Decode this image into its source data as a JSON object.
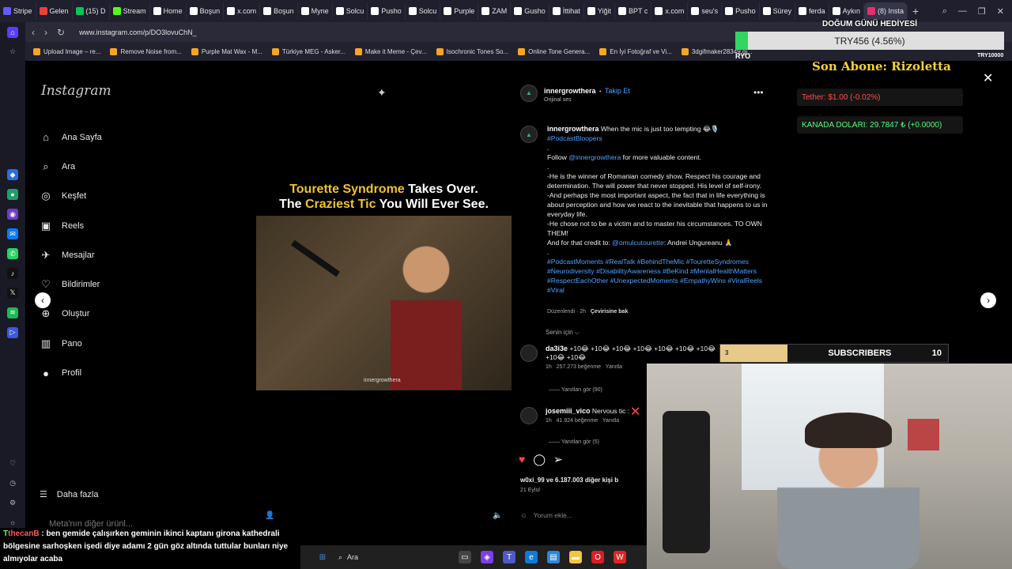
{
  "browser": {
    "tabs": [
      {
        "label": "Stripe",
        "color": "#635bff"
      },
      {
        "label": "Gelen",
        "color": "#ea4335"
      },
      {
        "label": "(15) D",
        "color": "#00c853"
      },
      {
        "label": "Stream",
        "color": "#53fc18"
      },
      {
        "label": "Home",
        "color": "#ffffff"
      },
      {
        "label": "Boşun",
        "color": "#ffffff"
      },
      {
        "label": "x.com",
        "color": "#ffffff"
      },
      {
        "label": "Boşun",
        "color": "#ffffff"
      },
      {
        "label": "Myne",
        "color": "#ffffff"
      },
      {
        "label": "Solcu",
        "color": "#ffffff"
      },
      {
        "label": "Pusho",
        "color": "#ffffff"
      },
      {
        "label": "Solcu",
        "color": "#ffffff"
      },
      {
        "label": "Purple",
        "color": "#ffffff"
      },
      {
        "label": "ZAM",
        "color": "#ffffff"
      },
      {
        "label": "Gusho",
        "color": "#ffffff"
      },
      {
        "label": "İttihat",
        "color": "#ffffff"
      },
      {
        "label": "Yiğit",
        "color": "#ffffff"
      },
      {
        "label": "BPT c",
        "color": "#ffffff"
      },
      {
        "label": "x.com",
        "color": "#ffffff"
      },
      {
        "label": "seu's",
        "color": "#ffffff"
      },
      {
        "label": "Pusho",
        "color": "#ffffff"
      },
      {
        "label": "Sürey",
        "color": "#ffffff"
      },
      {
        "label": "ferda",
        "color": "#ffffff"
      },
      {
        "label": "Aykın",
        "color": "#ffffff"
      },
      {
        "label": "(8) Insta",
        "color": "#e1306c",
        "active": true
      }
    ],
    "new_tab": "+",
    "url": "www.instagram.com/p/DO3lovuChN_",
    "bookmarks": [
      "Upload Image – re...",
      "Remove Noise from...",
      "Purple Mat Wax - M...",
      "Türkiye MEG - Asker...",
      "Make it Meme - Çev...",
      "Isochronic Tones So...",
      "Online Tone Genera...",
      "En İyi Fotoğraf ve Vi...",
      "3dgifmaker28349.gi..."
    ]
  },
  "instagram": {
    "logo": "Instagram",
    "nav": [
      {
        "label": "Ana Sayfa",
        "icon": "⌂"
      },
      {
        "label": "Ara",
        "icon": "⌕"
      },
      {
        "label": "Keşfet",
        "icon": "◎"
      },
      {
        "label": "Reels",
        "icon": "▣"
      },
      {
        "label": "Mesajlar",
        "icon": "✈"
      },
      {
        "label": "Bildirimler",
        "icon": "♡"
      },
      {
        "label": "Oluştur",
        "icon": "⊕"
      },
      {
        "label": "Pano",
        "icon": "▥"
      },
      {
        "label": "Profil",
        "icon": "●"
      }
    ],
    "more": "Daha fazla",
    "meta": "Meta'nın diğer ürünl..."
  },
  "post": {
    "video_title_line1_hl": "Tourette Syndrome",
    "video_title_line1_rest": " Takes Over.",
    "video_title_line2_pre": "The ",
    "video_title_line2_hl": "Craziest Tic",
    "video_title_line2_rest": " You Will Ever See.",
    "watermark": "innergrowthera",
    "author": "innergrowthera",
    "follow": "Takip Et",
    "audio": "Orijinal ses",
    "caption_lines": [
      {
        "user": "innergrowthera",
        "text": " When the mic is just too tempting 😂🎙️"
      },
      {
        "tag": "#PodcastBloopers"
      },
      {
        "text": "."
      },
      {
        "text": "Follow ",
        "tag": "@innergrowthera",
        "text2": " for more valuable content."
      },
      {
        "text": "."
      },
      {
        "text": "-He is the winner of Romanian comedy show. Respect his courage and determination. The will power that never stopped. His level of self-irony."
      },
      {
        "text": "-And perhaps the most important aspect, the fact that in life everything is about perception and how we react to the inevitable that happens to us in everyday life."
      },
      {
        "text": "-He chose not to be a victim and to master his circumstances. TO OWN THEM!"
      },
      {
        "text": "And for that credit to: ",
        "tag": "@omulcutourette",
        "text2": ": Andrei Ungureanu 🙏"
      },
      {
        "text": "."
      },
      {
        "tag": "#PodcastMoments #RealTalk #BehindTheMic #TouretteSyndromes #Neurodiversity #DisabilityAwareness #BeKind #MentalHealthMatters #RespectEachOther #UnexpectedMoments #EmpathyWins #ViralReels #Viral"
      }
    ],
    "edited": "Düzenlendi · 2h",
    "translate": "Çevirisine bak",
    "for_you": "Senin için ⌵",
    "comments": [
      {
        "user": "da3i3e",
        "text": " +10😂 +10😂 +10😂 +10😂 +10😂 +10😂 +10😂 +10😂 +10😂",
        "time": "1h",
        "likes": "257.273 beğenme",
        "reply": "Yanıtla",
        "replies": "Yanıtları gör (90)"
      },
      {
        "user": "josemiii_vico",
        "text": " Nervous tic : ❌",
        "time": "1h",
        "likes": "41.924 beğenme",
        "reply": "Yanıtla",
        "replies": "Yanıtları gör (5)"
      }
    ],
    "liked_by": "w0xi_99 ve 6.187.003 diğer kişi b",
    "date": "21 Eylül",
    "add_comment": "Yorum ekle..."
  },
  "stream": {
    "birthday": "DOĞUM GÜNÜ HEDİYESİ",
    "goal": "TRY456 (4.56%)",
    "goal_fraction": 0.0456,
    "goal_left": "RYO",
    "goal_right": "TRY10000",
    "last_sub": "Son Abone: Rizoletta",
    "tether": "Tether: $1.00 (-0.02%)",
    "cad": "KANADA DOLARI: 29.7847 ₺ (+0.0000)",
    "subs_progress": "3",
    "subs_label": "SUBSCRIBERS",
    "subs_count": "10",
    "chat_user": "thecanB",
    "chat_text": " : ben gemide çalışırken geminin ikinci kaptanı girona kathedrali bölgesine sarhoşken işedi diye adamı 2 gün göz altında tuttular bunları niye almıyolar acaba"
  },
  "taskbar": {
    "search": "Ara"
  },
  "colors": {
    "accent_blue": "#4da3ff",
    "highlight_yellow": "#f2c230",
    "like_red": "#ed4956",
    "goal_green": "#35d45e"
  }
}
